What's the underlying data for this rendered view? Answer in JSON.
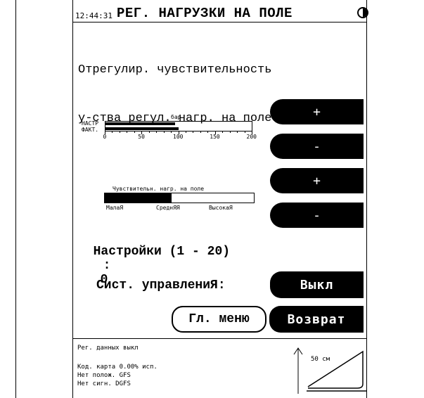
{
  "header": {
    "time": "12:44:31",
    "title": "РЕГ. НАГРУЗКИ НА ПОЛЕ",
    "contrast_icon": "contrast-icon"
  },
  "description": {
    "line1": "Отрегулир. чувствительность",
    "line2": "у-ства регул. нагр. на поле"
  },
  "load_gauge": {
    "unit_label": "бар",
    "set_label": "НАСТР",
    "actual_label": "ФАКТ.",
    "ticks": [
      "0",
      "50",
      "100",
      "150",
      "200"
    ],
    "max": 200,
    "set_value": 95,
    "actual_value": 100
  },
  "sensitivity_gauge": {
    "title": "Чувствительн. нагр. на поле",
    "labels": [
      "МалаЯ",
      "СреднЯЯ",
      "ВысокаЯ"
    ],
    "level": 0.45
  },
  "buttons": {
    "load_plus": "+",
    "load_minus": "-",
    "sens_plus": "+",
    "sens_minus": "-",
    "control_state": "Выкл",
    "main_menu": "Гл. меню",
    "back": "Возврат"
  },
  "settings": {
    "label": "Настройки (1 - 20)",
    "separator": ":",
    "value": "0"
  },
  "control_system": {
    "label": "Сист. управлениЯ:"
  },
  "footer": {
    "line1": "Рег. данных выкл",
    "line2": "Код. карта   0.00% исп.",
    "line3": "Нет полож. GFS",
    "line4": "Нет сигн. DGFS",
    "distance": "50 см"
  }
}
